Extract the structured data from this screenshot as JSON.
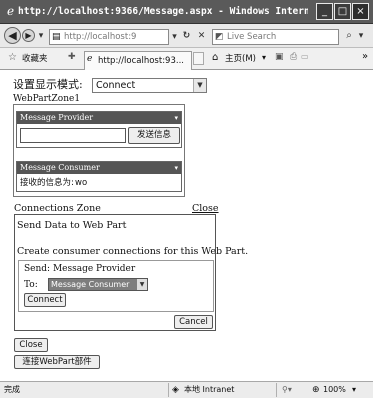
{
  "window": {
    "title": "http://localhost:9366/Message.aspx - Windows Intern...",
    "minimize_glyph": "_",
    "restore_glyph": "□",
    "close_glyph": "×"
  },
  "address_bar": {
    "url": "http://localhost:9",
    "search_placeholder": "Live Search"
  },
  "tab_bar": {
    "favorites_label": "收藏夹",
    "tab_label": "http://localhost:93...",
    "home_label": "主页(M)",
    "more_glyph": "»"
  },
  "page": {
    "mode_label": "设置显示模式:",
    "mode_value": "Connect",
    "zone_title": "WebPartZone1",
    "provider": {
      "title": "Message Provider",
      "send_button": "发送信息"
    },
    "consumer": {
      "title": "Message Consumer",
      "received_label": "接收的信息为:",
      "received_value": "wo"
    },
    "connections_zone": {
      "title": "Connections Zone",
      "close_link": "Close",
      "send_data_to": "Send Data to Web Part",
      "create_text": "Create consumer connections for this Web Part.",
      "send_label": "Send: Message Provider",
      "to_label": "To:",
      "to_value": "Message Consumer",
      "connect_button": "Connect",
      "cancel_button": "Cancel"
    },
    "close_button": "Close",
    "connect_webpart_button": "连接WebPart部件"
  },
  "status_bar": {
    "status": "完成",
    "zone": "本地 Intranet",
    "zoom": "100%"
  }
}
